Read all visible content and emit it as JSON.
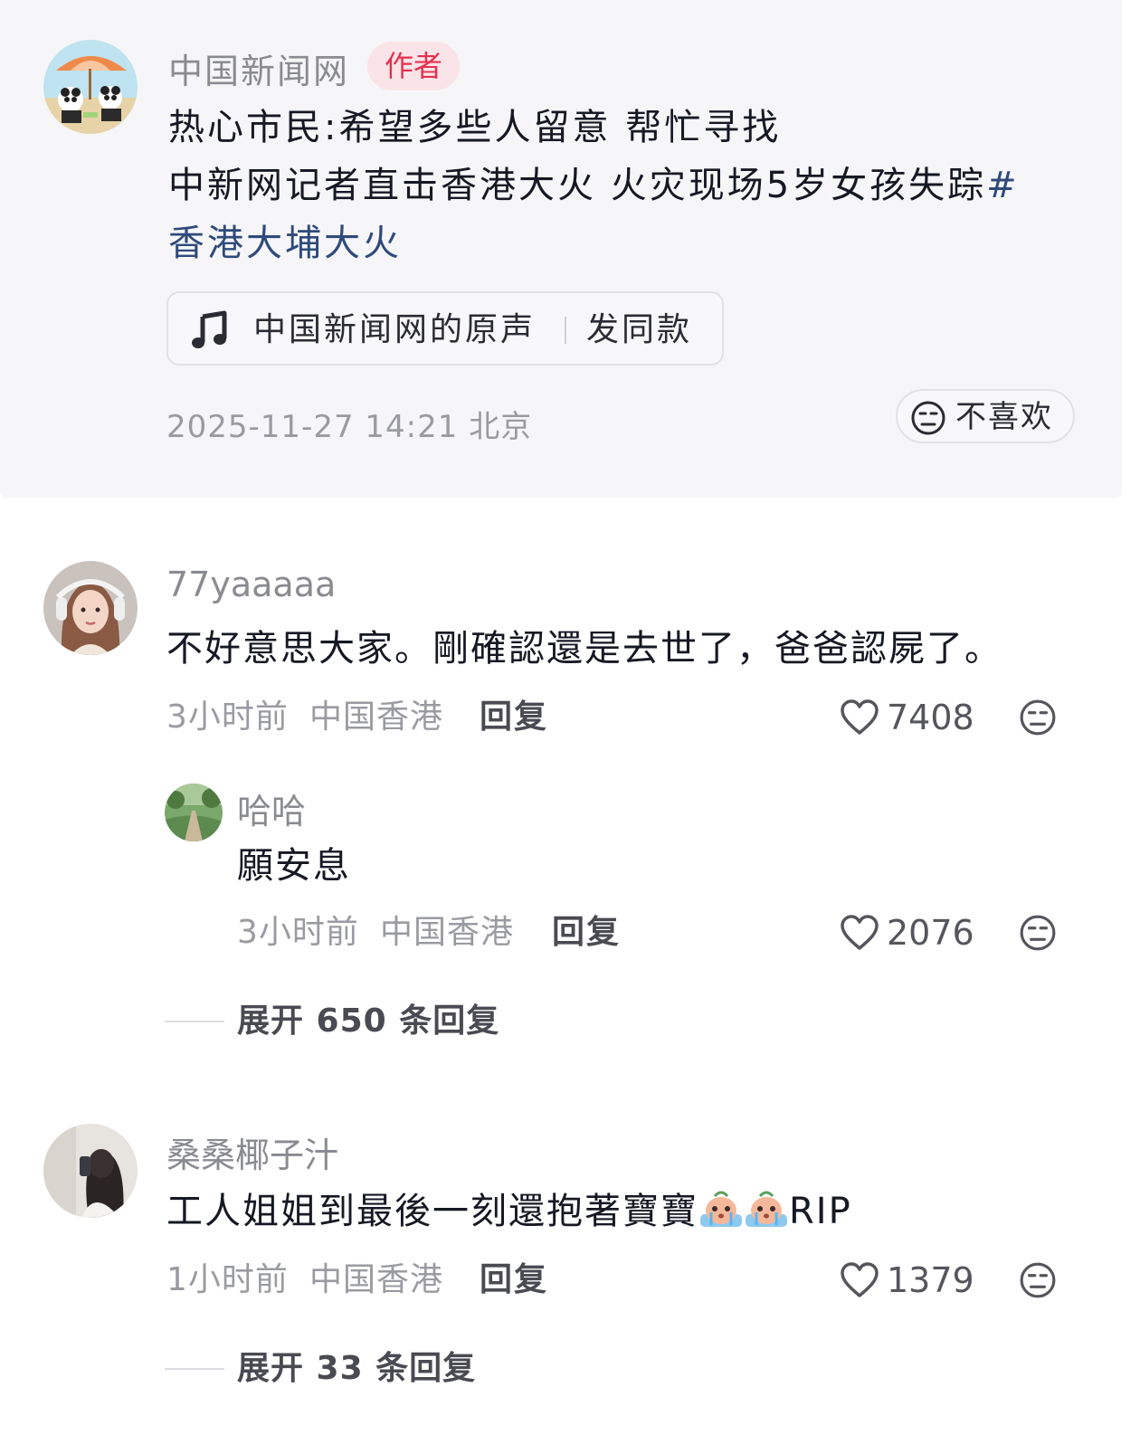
{
  "post": {
    "author_name": "中国新闻网",
    "author_badge": "作者",
    "line1": "热心市民:希望多些人留意 帮忙寻找",
    "line2_text": "中新网记者直击香港大火 火灾现场5岁女孩失踪",
    "line2_hash": "#",
    "line3_hashtag": "香港大埔大火",
    "music_title": "中国新闻网的原声",
    "music_action": "发同款",
    "meta": "2025-11-27 14:21 北京",
    "dislike_label": "不喜欢"
  },
  "comments": [
    {
      "username": "77yaaaaa",
      "text": "不好意思大家。剛確認還是去世了，爸爸認屍了。",
      "time": "3小时前",
      "location": "中国香港",
      "reply_label": "回复",
      "likes": "7408"
    },
    {
      "username": "桑桑椰子汁",
      "text": "工人姐姐到最後一刻還抱著寶寶",
      "text_suffix": "RIP",
      "time": "1小时前",
      "location": "中国香港",
      "reply_label": "回复",
      "likes": "1379",
      "expand_label": "展开 33 条回复"
    }
  ],
  "reply": {
    "username": "哈哈",
    "text": "願安息",
    "time": "3小时前",
    "location": "中国香港",
    "reply_label": "回复",
    "likes": "2076",
    "expand_label": "展开 650 条回复"
  },
  "icons": {
    "music": "music-note-icon",
    "dislike": "dislike-face-icon",
    "like": "heart-icon",
    "emoji": "crying-emoji-icon"
  },
  "colors": {
    "post_bg": "#f6f6f8",
    "author_badge_bg": "#fbe4e7",
    "author_badge_text": "#e33150",
    "hashtag": "#2f4a7a"
  }
}
